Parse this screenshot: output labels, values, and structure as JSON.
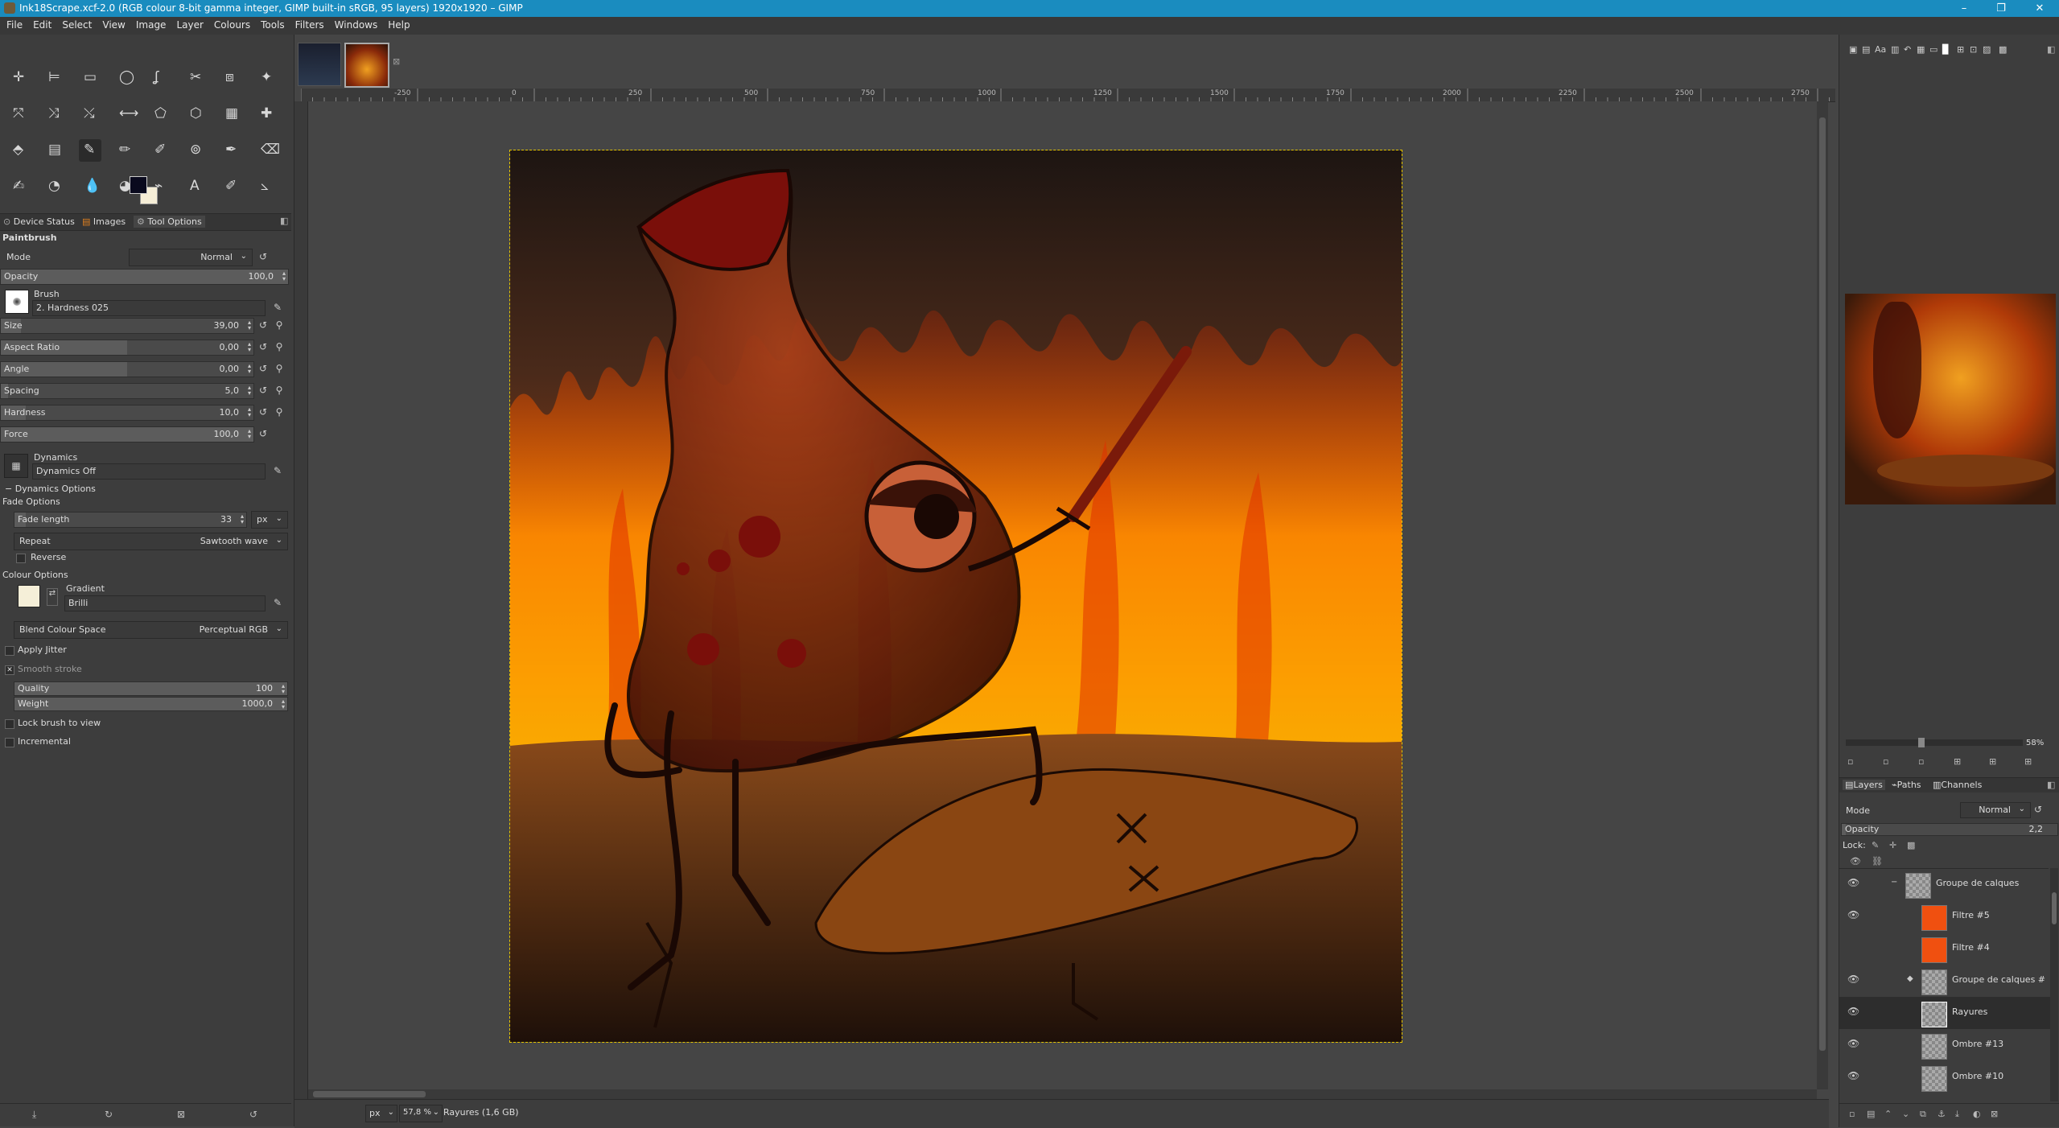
{
  "window": {
    "title": "Ink18Scrape.xcf-2.0 (RGB colour 8-bit gamma integer, GIMP built-in sRGB, 95 layers) 1920x1920 – GIMP",
    "minimize": "–",
    "maximize": "❐",
    "close": "✕"
  },
  "menubar": [
    "File",
    "Edit",
    "Select",
    "View",
    "Image",
    "Layer",
    "Colours",
    "Tools",
    "Filters",
    "Windows",
    "Help"
  ],
  "toolbox": {
    "tabs": [
      "Device Status",
      "Images",
      "Tool Options"
    ],
    "tool_name": "Paintbrush",
    "mode_label": "Mode",
    "mode_value": "Normal",
    "opacity": {
      "label": "Opacity",
      "value": "100,0",
      "fraction": 1.0
    },
    "brush_label": "Brush",
    "brush_name": "2. Hardness 025",
    "size": {
      "label": "Size",
      "value": "39,00",
      "fraction": 0.02
    },
    "aspect_ratio": {
      "label": "Aspect Ratio",
      "value": "0,00",
      "fraction": 0.5
    },
    "angle": {
      "label": "Angle",
      "value": "0,00",
      "fraction": 0.5
    },
    "spacing": {
      "label": "Spacing",
      "value": "5,0",
      "fraction": 0.025
    },
    "hardness": {
      "label": "Hardness",
      "value": "10,0",
      "fraction": 0.1
    },
    "force": {
      "label": "Force",
      "value": "100,0",
      "fraction": 1.0
    },
    "dynamics_label": "Dynamics",
    "dynamics_value": "Dynamics Off",
    "dynamics_options": "Dynamics Options",
    "fade_options": "Fade Options",
    "fade_length": {
      "label": "Fade length",
      "value": "33",
      "fraction": 0.05
    },
    "fade_unit": "px",
    "repeat_label": "Repeat",
    "repeat_value": "Sawtooth wave",
    "reverse": "Reverse",
    "colour_options": "Colour Options",
    "gradient_label": "Gradient",
    "gradient_value": "Brilli",
    "blend_label": "Blend Colour Space",
    "blend_value": "Perceptual RGB",
    "apply_jitter": "Apply Jitter",
    "smooth_stroke": "Smooth stroke",
    "quality": {
      "label": "Quality",
      "value": "100",
      "fraction": 1.0
    },
    "weight": {
      "label": "Weight",
      "value": "1000,0",
      "fraction": 1.0
    },
    "lock_brush": "Lock brush to view",
    "incremental": "Incremental"
  },
  "ruler_ticks": [
    "-250",
    "0",
    "250",
    "500",
    "750",
    "1000",
    "1250",
    "1500",
    "1750",
    "2000",
    "2250",
    "2500",
    "2750"
  ],
  "statusbar": {
    "unit": "px",
    "zoom": "57,8 %",
    "info": "Rayures (1,6 GB)"
  },
  "navigator": {
    "zoom_label": "58%"
  },
  "layers_panel": {
    "tabs": [
      "Layers",
      "Paths",
      "Channels"
    ],
    "mode_label": "Mode",
    "mode_value": "Normal",
    "opacity_label": "Opacity",
    "opacity_value": "2,2",
    "lock_label": "Lock:",
    "layers": [
      {
        "name": "Groupe de calques",
        "type": "group",
        "visible": true
      },
      {
        "name": "Filtre #5",
        "type": "orange",
        "visible": true
      },
      {
        "name": "Filtre #4",
        "type": "orange",
        "visible": false
      },
      {
        "name": "Groupe de calques #",
        "type": "group",
        "visible": true
      },
      {
        "name": "Rayures",
        "type": "layer",
        "visible": true,
        "selected": true
      },
      {
        "name": "Ombre #13",
        "type": "layer",
        "visible": true
      },
      {
        "name": "Ombre #10",
        "type": "layer",
        "visible": true
      }
    ]
  },
  "colors": {
    "accent_titlebar": "#1a8cbf",
    "fg_color": "#0a0a1e",
    "bg_color": "#f5edd6",
    "layer_orange": "#f05010"
  }
}
